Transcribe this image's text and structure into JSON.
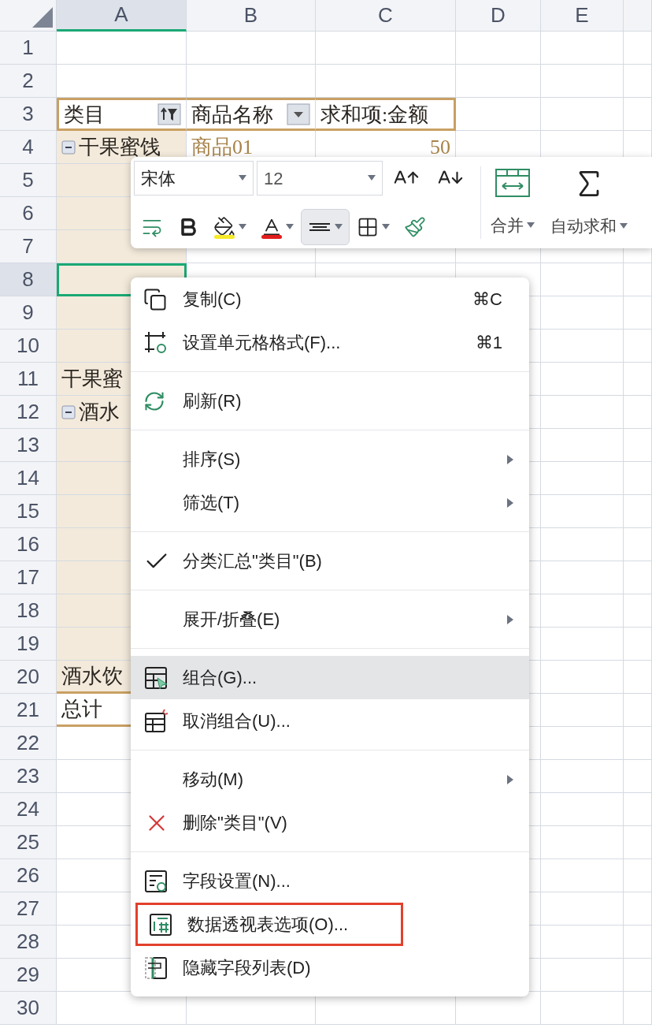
{
  "sheet": {
    "columns": [
      {
        "label": "A",
        "selected": true
      },
      {
        "label": "B",
        "selected": false
      },
      {
        "label": "C",
        "selected": false
      },
      {
        "label": "D",
        "selected": false
      },
      {
        "label": "E",
        "selected": false
      },
      {
        "selected": false
      }
    ],
    "rows": [
      {
        "label": "1",
        "selected": false,
        "kind": "blank",
        "cells": []
      },
      {
        "label": "2",
        "selected": false,
        "kind": "blank",
        "cells": []
      },
      {
        "label": "3",
        "selected": false,
        "kind": "pivot_header",
        "cells": [
          {
            "text": "类目",
            "kind": "label",
            "sort_filter": true
          },
          {
            "text": "商品名称",
            "kind": "label",
            "dropdown": true
          },
          {
            "text": "求和项:金额",
            "kind": "label"
          }
        ]
      },
      {
        "label": "4",
        "selected": false,
        "kind": "pivot_body",
        "cells": [
          {
            "text": "干果蜜饯",
            "kind": "label",
            "collapse": true
          },
          {
            "text": "商品01",
            "kind": "item"
          },
          {
            "text": "50",
            "kind": "value"
          }
        ]
      },
      {
        "label": "5",
        "selected": false,
        "kind": "pivot_body",
        "cells": []
      },
      {
        "label": "6",
        "selected": false,
        "kind": "pivot_body",
        "cells": []
      },
      {
        "label": "7",
        "selected": false,
        "kind": "pivot_body",
        "cells": []
      },
      {
        "label": "8",
        "selected": true,
        "kind": "pivot_body",
        "cells": []
      },
      {
        "label": "9",
        "selected": false,
        "kind": "pivot_body",
        "cells": []
      },
      {
        "label": "10",
        "selected": false,
        "kind": "pivot_body",
        "cells": []
      },
      {
        "label": "11",
        "selected": false,
        "kind": "pivot_body",
        "cells": [
          {
            "text": "干果蜜",
            "kind": "label"
          }
        ]
      },
      {
        "label": "12",
        "selected": false,
        "kind": "pivot_body",
        "cells": [
          {
            "text": "酒水",
            "kind": "label",
            "collapse": true
          }
        ]
      },
      {
        "label": "13",
        "selected": false,
        "kind": "pivot_body",
        "cells": []
      },
      {
        "label": "14",
        "selected": false,
        "kind": "pivot_body",
        "cells": []
      },
      {
        "label": "15",
        "selected": false,
        "kind": "pivot_body",
        "cells": []
      },
      {
        "label": "16",
        "selected": false,
        "kind": "pivot_body",
        "cells": []
      },
      {
        "label": "17",
        "selected": false,
        "kind": "pivot_body",
        "cells": []
      },
      {
        "label": "18",
        "selected": false,
        "kind": "pivot_body",
        "cells": []
      },
      {
        "label": "19",
        "selected": false,
        "kind": "pivot_body",
        "cells": []
      },
      {
        "label": "20",
        "selected": false,
        "kind": "pivot_subtotal",
        "cells": [
          {
            "text": "酒水饮",
            "kind": "label"
          }
        ]
      },
      {
        "label": "21",
        "selected": false,
        "kind": "pivot_total",
        "cells": [
          {
            "text": "总计",
            "kind": "label"
          }
        ]
      },
      {
        "label": "22",
        "selected": false,
        "kind": "blank",
        "cells": []
      },
      {
        "label": "23",
        "selected": false,
        "kind": "blank",
        "cells": []
      },
      {
        "label": "24",
        "selected": false,
        "kind": "blank",
        "cells": []
      },
      {
        "label": "25",
        "selected": false,
        "kind": "blank",
        "cells": []
      },
      {
        "label": "26",
        "selected": false,
        "kind": "blank",
        "cells": []
      },
      {
        "label": "27",
        "selected": false,
        "kind": "blank",
        "cells": []
      },
      {
        "label": "28",
        "selected": false,
        "kind": "blank",
        "cells": []
      },
      {
        "label": "29",
        "selected": false,
        "kind": "blank",
        "cells": []
      },
      {
        "label": "30",
        "selected": false,
        "kind": "blank",
        "cells": []
      }
    ]
  },
  "toolbar": {
    "font": "宋体",
    "size": "12",
    "tools": [
      {
        "kind": "grow",
        "selected": false
      },
      {
        "kind": "shrink",
        "selected": false
      },
      {
        "kind": "wrap",
        "selected": false
      },
      {
        "kind": "bold",
        "selected": false
      },
      {
        "kind": "fill",
        "selected": false
      },
      {
        "kind": "color",
        "selected": false
      },
      {
        "kind": "align",
        "selected": true
      },
      {
        "kind": "border",
        "selected": false
      },
      {
        "kind": "painter",
        "selected": false
      }
    ],
    "big": [
      {
        "kind": "merge",
        "label": "合并"
      },
      {
        "kind": "sum",
        "label": "自动求和"
      }
    ]
  },
  "context_menu": {
    "groups": [
      {
        "items": [
          {
            "label": "复制(C)",
            "shortcut": "⌘C",
            "submenu": false,
            "checked": false,
            "selected": false,
            "outlined": false
          },
          {
            "label": "设置单元格格式(F)...",
            "shortcut": "⌘1",
            "submenu": false,
            "checked": false,
            "selected": false,
            "outlined": false
          }
        ]
      },
      {
        "items": [
          {
            "label": "刷新(R)",
            "submenu": false,
            "checked": false,
            "selected": false,
            "outlined": false
          }
        ]
      },
      {
        "items": [
          {
            "label": "排序(S)",
            "submenu": true,
            "checked": false,
            "selected": false,
            "outlined": false
          },
          {
            "label": "筛选(T)",
            "submenu": true,
            "checked": false,
            "selected": false,
            "outlined": false
          }
        ]
      },
      {
        "items": [
          {
            "label": "分类汇总\"类目\"(B)",
            "submenu": false,
            "checked": true,
            "selected": false,
            "outlined": false
          }
        ]
      },
      {
        "items": [
          {
            "label": "展开/折叠(E)",
            "submenu": true,
            "checked": false,
            "selected": false,
            "outlined": false
          }
        ]
      },
      {
        "items": [
          {
            "label": "组合(G)...",
            "submenu": false,
            "checked": false,
            "selected": true,
            "outlined": false
          },
          {
            "label": "取消组合(U)...",
            "submenu": false,
            "checked": false,
            "selected": false,
            "outlined": false
          }
        ]
      },
      {
        "items": [
          {
            "label": "移动(M)",
            "submenu": true,
            "checked": false,
            "selected": false,
            "outlined": false
          },
          {
            "label": "删除\"类目\"(V)",
            "submenu": false,
            "checked": false,
            "selected": false,
            "outlined": false
          }
        ]
      },
      {
        "items": [
          {
            "label": "字段设置(N)...",
            "submenu": false,
            "checked": false,
            "selected": false,
            "outlined": false
          },
          {
            "label": "数据透视表选项(O)...",
            "submenu": false,
            "checked": false,
            "selected": false,
            "outlined": true
          },
          {
            "label": "隐藏字段列表(D)",
            "submenu": false,
            "checked": false,
            "selected": false,
            "outlined": false
          }
        ]
      }
    ]
  }
}
